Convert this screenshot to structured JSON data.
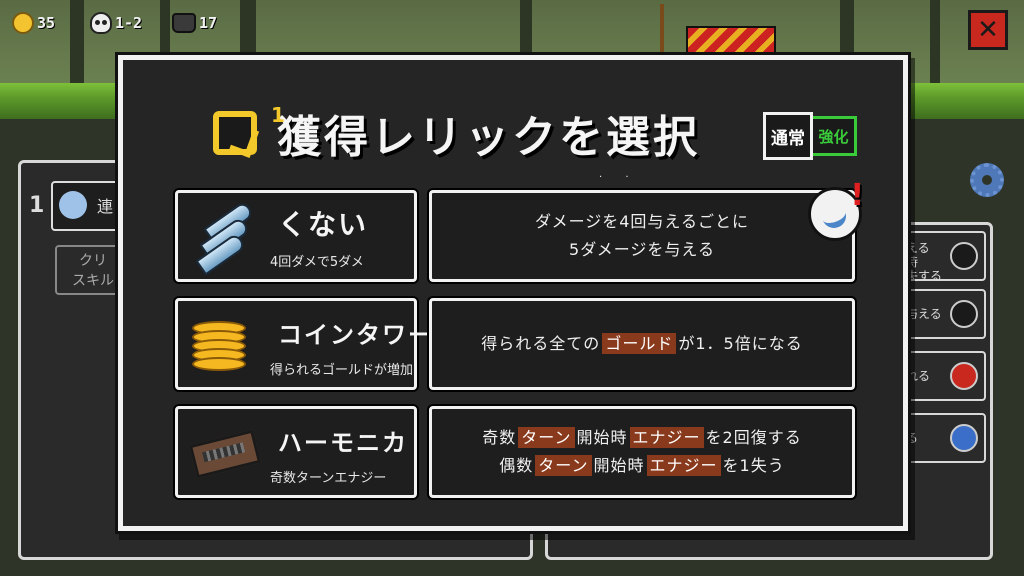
{
  "hud": {
    "coins": "35",
    "stage": "1-2",
    "cats": "17"
  },
  "background": {
    "left_index": "1",
    "left_card_label": "連",
    "left_sub_line1": "クリ",
    "left_sub_line2": "スキル",
    "right_rows": [
      {
        "line1": "える",
        "line2": "時",
        "line3": "失する"
      },
      {
        "line1": "与える",
        "line2": "",
        "line3": ""
      },
      {
        "line1": "れる",
        "line2": "",
        "line3": ""
      },
      {
        "line1": "る",
        "line2": "",
        "line3": ""
      }
    ]
  },
  "modal": {
    "title": "獲得レリックを選択",
    "relic_icon_sup": "1",
    "mode_normal": "通常",
    "mode_upgrade": "強化",
    "relics": [
      {
        "name": "くない",
        "subtitle": "4回ダメで5ダメ",
        "desc_line1": [
          {
            "t": "ダメージを4回与えるごとに",
            "hl": false
          }
        ],
        "desc_line2": [
          {
            "t": "5ダメージを与える",
            "hl": false
          }
        ]
      },
      {
        "name": "コインタワー",
        "subtitle": "得られるゴールドが増加",
        "desc_line1": [
          {
            "t": "得られる全ての",
            "hl": false
          },
          {
            "t": "ゴールド",
            "hl": true
          },
          {
            "t": "が1．5倍になる",
            "hl": false
          }
        ]
      },
      {
        "name": "ハーモニカ",
        "subtitle": "奇数ターンエナジー",
        "desc_line1": [
          {
            "t": "奇数",
            "hl": false
          },
          {
            "t": "ターン",
            "hl": true
          },
          {
            "t": "開始時",
            "hl": false
          },
          {
            "t": "エナジー",
            "hl": true
          },
          {
            "t": "を2回復する",
            "hl": false
          }
        ],
        "desc_line2": [
          {
            "t": "偶数",
            "hl": false
          },
          {
            "t": "ターン",
            "hl": true
          },
          {
            "t": "開始時",
            "hl": false
          },
          {
            "t": "エナジー",
            "hl": true
          },
          {
            "t": "を1失う",
            "hl": false
          }
        ]
      }
    ]
  },
  "colors": {
    "highlight": "#8a3a1c",
    "close": "#c8281e",
    "upgrade_green": "#3acb3a",
    "coin_gold": "#f4c430"
  },
  "icons": [
    "coin-icon",
    "skull-icon",
    "cat-icon",
    "close-icon",
    "gear-icon",
    "relic-select-icon",
    "kunai-icon",
    "coin-tower-icon",
    "harmonica-icon",
    "kunai-badge-icon"
  ]
}
